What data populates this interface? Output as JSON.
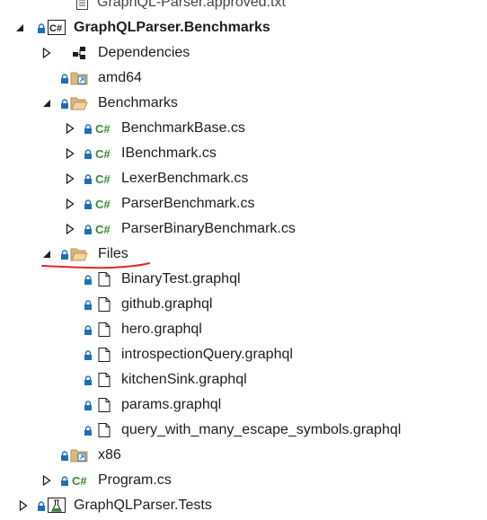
{
  "tree": {
    "approved_file": "GraphQL-Parser.approved.txt",
    "project_benchmarks": "GraphQLParser.Benchmarks",
    "dependencies": "Dependencies",
    "amd64": "amd64",
    "benchmarks_folder": "Benchmarks",
    "benchmark_files": [
      "BenchmarkBase.cs",
      "IBenchmark.cs",
      "LexerBenchmark.cs",
      "ParserBenchmark.cs",
      "ParserBinaryBenchmark.cs"
    ],
    "files_folder": "Files",
    "graphql_files": [
      "BinaryTest.graphql",
      "github.graphql",
      "hero.graphql",
      "introspectionQuery.graphql",
      "kitchenSink.graphql",
      "params.graphql",
      "query_with_many_escape_symbols.graphql"
    ],
    "x86": "x86",
    "program": "Program.cs",
    "project_tests": "GraphQLParser.Tests"
  },
  "colors": {
    "folder": "#dcb67a",
    "lock": "#1f6fb5",
    "csharp": "#388a34",
    "annotation": "#e0262a"
  }
}
